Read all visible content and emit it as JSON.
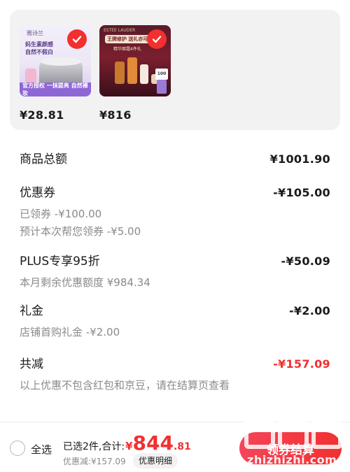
{
  "products": [
    {
      "price": "¥28.81",
      "thumb_texts": {
        "brand": "雅诗兰",
        "headline": "妈生素颜感\n自然不假白",
        "banner": "官方授权 一抹提亮 自然裸妆"
      }
    },
    {
      "price": "¥816",
      "thumb_texts": {
        "topbar": "ESTEE LAUDER",
        "headline": "王牌修护 送礼亦可",
        "sub": "精华面霜4件礼",
        "tag": "100"
      }
    }
  ],
  "summary": {
    "goods_total": {
      "label": "商品总额",
      "value": "¥1001.90"
    },
    "coupon": {
      "label": "优惠券",
      "value": "-¥105.00",
      "claimed": "已领券 -¥100.00",
      "estimate": "预计本次帮您领券 -¥5.00"
    },
    "plus": {
      "label": "PLUS专享95折",
      "value": "-¥50.09",
      "remaining": "本月剩余优惠额度 ¥984.34"
    },
    "gift": {
      "label": "礼金",
      "value": "-¥2.00",
      "detail": "店铺首购礼金 -¥2.00"
    },
    "total_discount": {
      "label": "共减",
      "value": "-¥157.09"
    },
    "note": "以上优惠不包含红包和京豆，请在结算页查看"
  },
  "bottom_bar": {
    "select_all": "全选",
    "selected_text": "已选2件,合计:",
    "total_symbol": "¥",
    "total_integer": "844",
    "total_decimal": ".81",
    "discount_text": "优惠减:¥157.09",
    "detail_button": "优惠明细",
    "checkout_button": "领券结算"
  },
  "watermark": {
    "text": "zhizhizhi.com"
  },
  "colors": {
    "accent": "#f23030",
    "muted": "#8a8a8a",
    "card_bg": "#f2f2f2"
  }
}
